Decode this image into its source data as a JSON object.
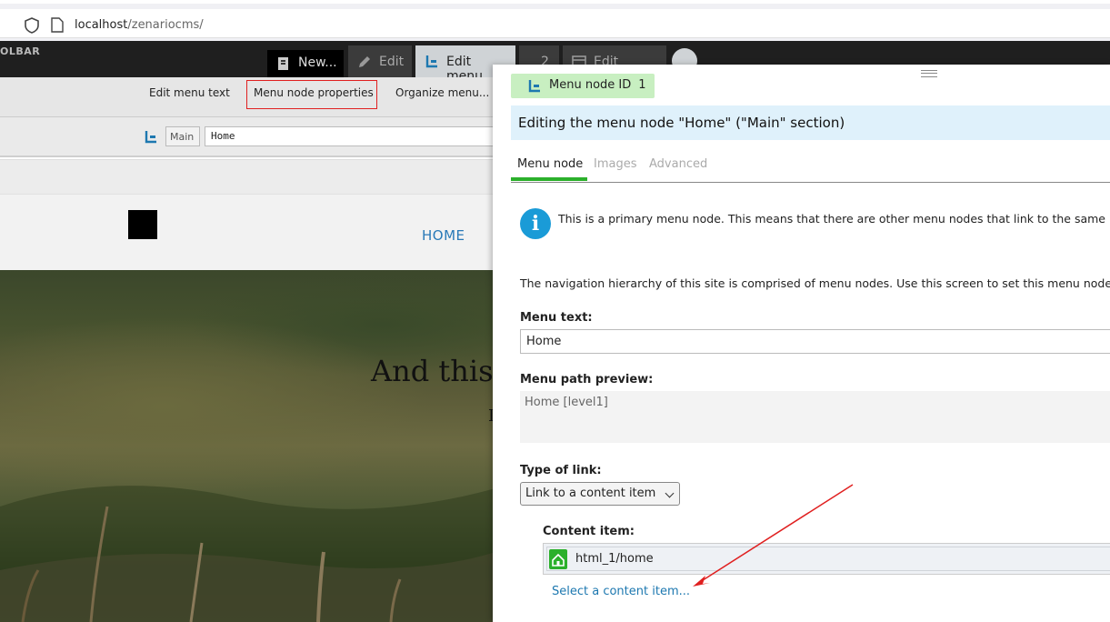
{
  "browser": {
    "url_host": "localhost",
    "url_path": "/zenariocms/"
  },
  "toolbar": {
    "label": "OLBAR",
    "new_label": "New...",
    "edit_label": "Edit",
    "edit_menu_label": "Edit menu",
    "count_label": "2",
    "edit_layout_label": "Edit layout"
  },
  "subbar": {
    "edit_menu_text": "Edit menu text",
    "menu_node_properties": "Menu node properties",
    "organize_menu": "Organize menu..."
  },
  "pathbar": {
    "section": "Main",
    "value": "Home"
  },
  "site": {
    "nav_home": "HOME",
    "hero_title": "And this",
    "hero_sub": "I"
  },
  "panel": {
    "id_label": "Menu node ID",
    "id_value": "1",
    "title": "Editing the menu node \"Home\" (\"Main\" section)",
    "tabs": [
      "Menu node",
      "Images",
      "Advanced"
    ],
    "info_text": "This is a primary menu node. This means that there are other menu nodes that link to the same",
    "nav_text": "The navigation hierarchy of this site is comprised of menu nodes. Use this screen to set this menu node",
    "menu_text_label": "Menu text:",
    "menu_text_value": "Home",
    "preview_label": "Menu path preview:",
    "preview_value": "Home [level1]",
    "type_label": "Type of link:",
    "type_value": "Link to a content item",
    "content_label": "Content item:",
    "content_value": "html_1/home",
    "select_link": "Select a content item..."
  },
  "colors": {
    "accent_green": "#2bb02b",
    "title_bar_bg": "#dff1fb",
    "link_blue": "#1d78b0",
    "highlight_red": "#e02020"
  }
}
